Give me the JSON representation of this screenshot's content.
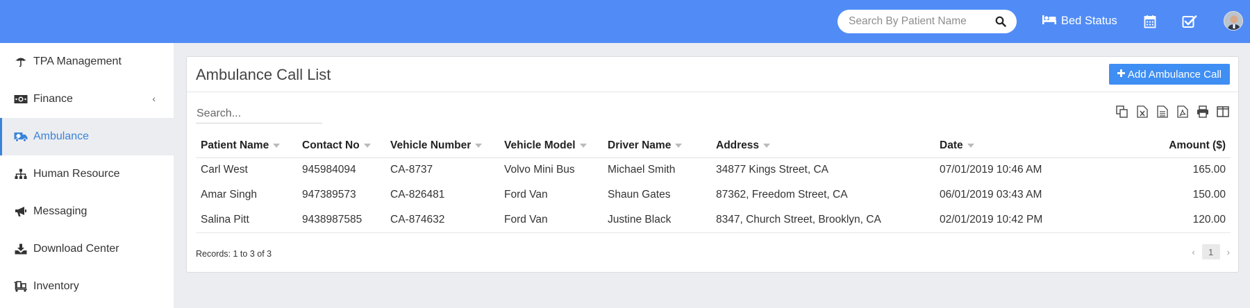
{
  "header": {
    "search_placeholder": "Search By Patient Name",
    "bed_status_label": "Bed Status",
    "icons": [
      "search-icon",
      "bed-icon",
      "calendar-icon",
      "task-check-icon",
      "user-avatar"
    ]
  },
  "sidebar": {
    "items": [
      {
        "label": "TPA Management",
        "icon": "umbrella-icon"
      },
      {
        "label": "Finance",
        "icon": "money-icon",
        "chevron": "‹"
      },
      {
        "label": "Ambulance",
        "icon": "ambulance-icon",
        "active": true
      },
      {
        "label": "Human Resource",
        "icon": "sitemap-icon"
      },
      {
        "label": "Messaging",
        "icon": "bullhorn-icon"
      },
      {
        "label": "Download Center",
        "icon": "download-icon"
      },
      {
        "label": "Inventory",
        "icon": "inventory-icon"
      }
    ]
  },
  "main": {
    "title": "Ambulance Call List",
    "add_button": "Add Ambulance Call",
    "search_placeholder": "Search...",
    "tools": [
      "copy-icon",
      "excel-icon",
      "csv-icon",
      "pdf-icon",
      "print-icon",
      "columns-icon"
    ],
    "columns": [
      "Patient Name",
      "Contact No",
      "Vehicle Number",
      "Vehicle Model",
      "Driver Name",
      "Address",
      "Date",
      "Amount ($)"
    ],
    "rows": [
      [
        "Carl West",
        "945984094",
        "CA-8737",
        "Volvo Mini Bus",
        "Michael Smith",
        "34877 Kings Street, CA",
        "07/01/2019 10:46 AM",
        "165.00"
      ],
      [
        "Amar Singh",
        "947389573",
        "CA-826481",
        "Ford Van",
        "Shaun Gates",
        "87362, Freedom Street, CA",
        "06/01/2019 03:43 AM",
        "150.00"
      ],
      [
        "Salina Pitt",
        "9438987585",
        "CA-874632",
        "Ford Van",
        "Justine Black",
        "8347, Church Street, Brooklyn, CA",
        "02/01/2019 10:42 PM",
        "120.00"
      ]
    ],
    "records_text": "Records: 1 to 3 of 3",
    "pagination": {
      "prev": "‹",
      "page": "1",
      "next": "›"
    }
  },
  "colors": {
    "topbar": "#518cf6",
    "accent": "#3a83d8",
    "button": "#3f8ef3",
    "background": "#ecedf1"
  }
}
